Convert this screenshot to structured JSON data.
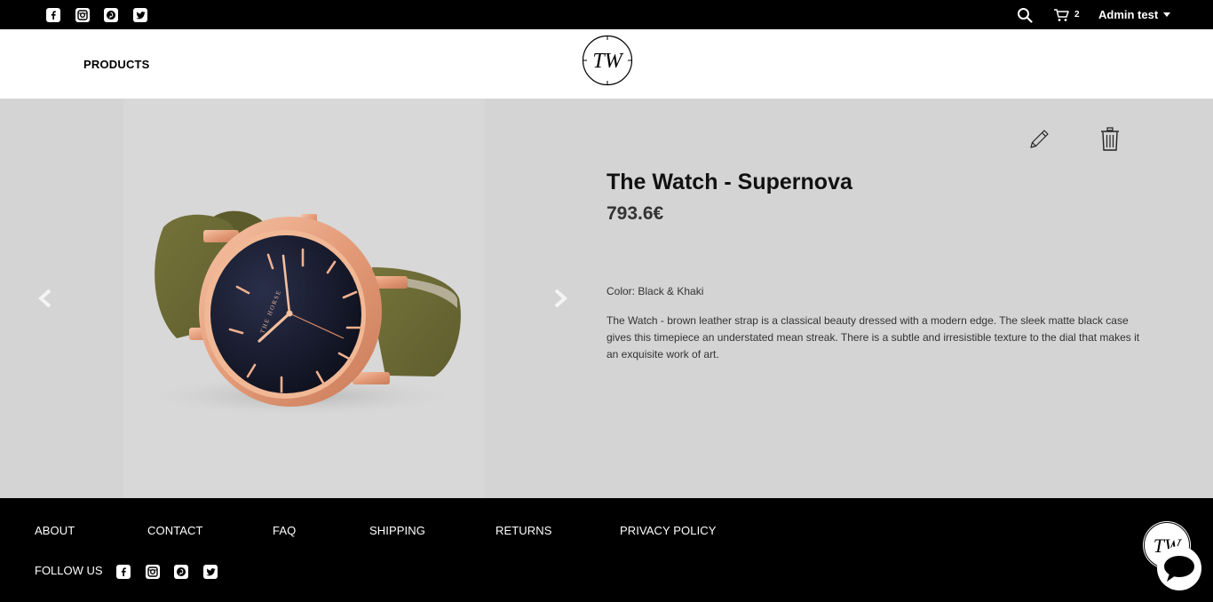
{
  "topbar": {
    "social_icons": [
      "facebook-icon",
      "instagram-icon",
      "pinterest-icon",
      "twitter-icon"
    ],
    "cart_count": "2",
    "user_name": "Admin test"
  },
  "header": {
    "nav_products": "PRODUCTS",
    "logo_text": "TW"
  },
  "product": {
    "title": "The Watch - Supernova",
    "price": "793.6€",
    "color": "Color: Black & Khaki",
    "description": "The Watch - brown leather strap is a classical beauty dressed with a modern edge. The sleek matte black case gives this timepiece an understated mean streak. There is a subtle and irresistible texture to the dial that makes it an exquisite work of art.",
    "watch_brand_text": "THE HORSE"
  },
  "footer": {
    "links": [
      "ABOUT",
      "CONTACT",
      "FAQ",
      "SHIPPING",
      "RETURNS",
      "PRIVACY POLICY"
    ],
    "follow_label": "FOLLOW US",
    "logo_text": "TW"
  },
  "colors": {
    "topbar_bg": "#000000",
    "main_bg": "#d4d4d4",
    "strap": "#6b6a34",
    "rose_gold": "#e8a27f",
    "dial": "#111426"
  }
}
